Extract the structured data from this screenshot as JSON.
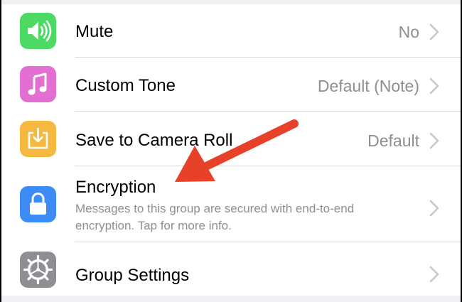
{
  "settings": {
    "items": [
      {
        "label": "Mute",
        "value": "No",
        "icon": "speaker-icon",
        "icon_color": "#4cd964"
      },
      {
        "label": "Custom Tone",
        "value": "Default (Note)",
        "icon": "music-note-icon",
        "icon_color": "#e36fd2"
      },
      {
        "label": "Save to Camera Roll",
        "value": "Default",
        "icon": "download-icon",
        "icon_color": "#f5b942"
      },
      {
        "label": "Encryption",
        "description": "Messages to this group are secured with end-to-end encryption. Tap for more info.",
        "icon": "lock-icon",
        "icon_color": "#3d8bf7"
      },
      {
        "label": "Group Settings",
        "icon": "gear-icon",
        "icon_color": "#8e8e93"
      }
    ]
  },
  "annotation": {
    "arrow_color": "#e8412a"
  },
  "colors": {
    "background": "#efeff4",
    "chevron": "#c7c7cc",
    "secondary_text": "#8e8e93"
  }
}
